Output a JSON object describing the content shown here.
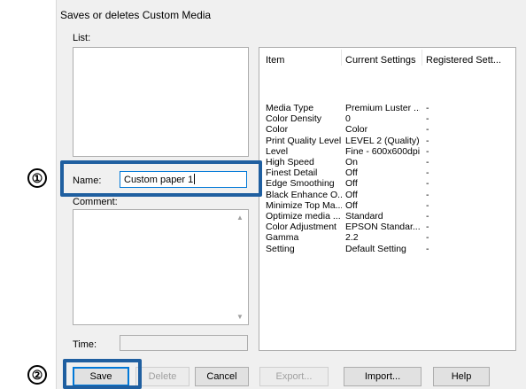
{
  "dialog": {
    "title": "Saves or deletes Custom Media",
    "list_label": "List:",
    "name_label": "Name:",
    "name_value": "Custom paper 1",
    "comment_label": "Comment:",
    "time_label": "Time:",
    "time_value": ""
  },
  "settings_table": {
    "headers": [
      "Item",
      "Current Settings",
      "Registered Sett..."
    ],
    "rows": [
      {
        "item": "Media Type",
        "current": "Premium Luster ...",
        "registered": "-"
      },
      {
        "item": "Color Density",
        "current": "0",
        "registered": "-"
      },
      {
        "item": "Color",
        "current": "Color",
        "registered": "-"
      },
      {
        "item": "Print Quality Level",
        "current": "LEVEL 2 (Quality)",
        "registered": "-"
      },
      {
        "item": "Level",
        "current": "Fine - 600x600dpi",
        "registered": "-"
      },
      {
        "item": "High Speed",
        "current": "On",
        "registered": "-"
      },
      {
        "item": "Finest Detail",
        "current": "Off",
        "registered": "-"
      },
      {
        "item": "Edge Smoothing",
        "current": "Off",
        "registered": "-"
      },
      {
        "item": "Black Enhance O...",
        "current": "Off",
        "registered": "-"
      },
      {
        "item": "Minimize Top Ma...",
        "current": "Off",
        "registered": "-"
      },
      {
        "item": "Optimize media ...",
        "current": "Standard",
        "registered": "-"
      },
      {
        "item": "Color Adjustment",
        "current": "EPSON Standar...",
        "registered": "-"
      },
      {
        "item": "Gamma",
        "current": "2.2",
        "registered": "-"
      },
      {
        "item": "Setting",
        "current": "Default Setting",
        "registered": "-"
      }
    ]
  },
  "buttons": {
    "save": "Save",
    "delete": "Delete",
    "cancel": "Cancel",
    "export": "Export...",
    "import": "Import...",
    "help": "Help"
  },
  "callouts": {
    "one": "①",
    "two": "②"
  },
  "colors": {
    "highlight": "#1f5fa0",
    "focus": "#0078d7",
    "dialog_bg": "#f0f0f0"
  },
  "icons": {
    "scroll_up": "▲",
    "scroll_down": "▼"
  }
}
